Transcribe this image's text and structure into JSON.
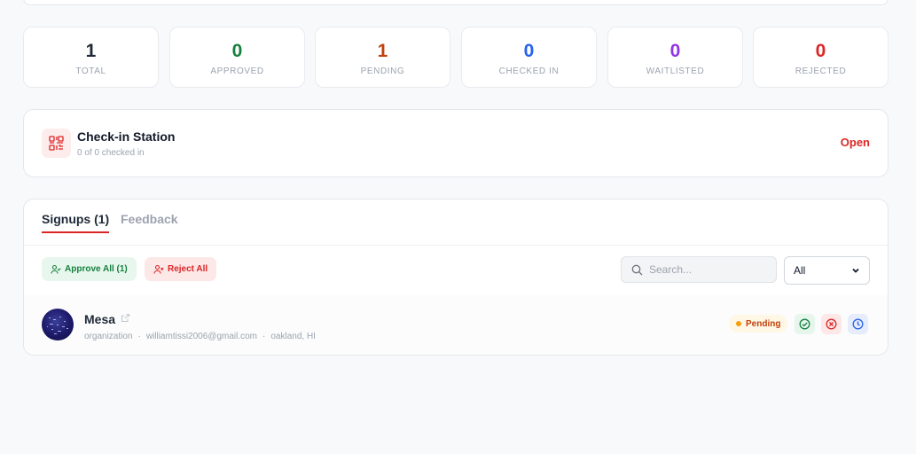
{
  "stats": [
    {
      "value": "1",
      "label": "TOTAL",
      "color": "#1f2937"
    },
    {
      "value": "0",
      "label": "APPROVED",
      "color": "#15803d"
    },
    {
      "value": "1",
      "label": "PENDING",
      "color": "#c2410c"
    },
    {
      "value": "0",
      "label": "CHECKED IN",
      "color": "#2563eb"
    },
    {
      "value": "0",
      "label": "WAITLISTED",
      "color": "#9333ea"
    },
    {
      "value": "0",
      "label": "REJECTED",
      "color": "#dc2626"
    }
  ],
  "checkin": {
    "title": "Check-in Station",
    "subtitle": "0 of 0 checked in",
    "open_label": "Open",
    "icon": "qr-code-icon"
  },
  "tabs": {
    "signups": "Signups (1)",
    "feedback": "Feedback"
  },
  "toolbar": {
    "approve_all": "Approve All (1)",
    "reject_all": "Reject All",
    "search_placeholder": "Search...",
    "filter_value": "All"
  },
  "signup": {
    "name": "Mesa",
    "type": "organization",
    "email": "williamtissi2006@gmail.com",
    "location": "oakland, HI",
    "status": "Pending"
  },
  "colors": {
    "accent": "#dc2626",
    "approve": "#15803d",
    "pending": "#c2410c",
    "waitlist": "#2563eb"
  }
}
